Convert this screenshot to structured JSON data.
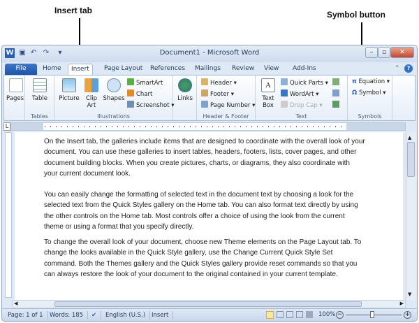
{
  "callouts": {
    "insert_tab": "Insert tab",
    "symbol_button": "Symbol button"
  },
  "window": {
    "title": "Document1 - Microsoft Word",
    "app_icon": "W",
    "controls": {
      "minimize": "–",
      "maximize": "▫",
      "close": "✕"
    }
  },
  "tabs": [
    {
      "label": "File"
    },
    {
      "label": "Home"
    },
    {
      "label": "Insert",
      "active": true
    },
    {
      "label": "Page Layout"
    },
    {
      "label": "References"
    },
    {
      "label": "Mailings"
    },
    {
      "label": "Review"
    },
    {
      "label": "View"
    },
    {
      "label": "Add-Ins"
    }
  ],
  "ribbon": {
    "pages": {
      "label": "Pages"
    },
    "tables": {
      "table": "Table",
      "group": "Tables"
    },
    "illustrations": {
      "picture": "Picture",
      "clip_art": "Clip Art",
      "shapes": "Shapes",
      "smartart": "SmartArt",
      "chart": "Chart",
      "screenshot": "Screenshot",
      "group": "Illustrations"
    },
    "links": {
      "label": "Links"
    },
    "header_footer": {
      "header": "Header",
      "footer": "Footer",
      "page_number": "Page Number",
      "group": "Header & Footer"
    },
    "text": {
      "text_box": "Text Box",
      "quick_parts": "Quick Parts",
      "wordart": "WordArt",
      "drop_cap": "Drop Cap",
      "group": "Text"
    },
    "symbols": {
      "equation": "Equation",
      "symbol": "Symbol",
      "group": "Symbols"
    }
  },
  "document": {
    "paragraphs": [
      "On the Insert tab, the galleries include items that are designed to coordinate with the overall look of your document. You can use these galleries to insert tables, headers, footers, lists, cover pages, and other document building blocks. When you create pictures, charts, or diagrams, they also coordinate with your current document look.",
      "You can easily change the formatting of selected text in the document text by choosing a look for the selected text from the Quick Styles gallery on the Home tab. You can also format text directly by using the other controls on the Home tab. Most controls offer a choice of using the look from the current theme or using a format that you specify directly.",
      "To change the overall look of your document, choose new Theme elements on the Page Layout tab. To change the looks available in the Quick Style gallery, use the Change Current Quick Style Set command. Both the Themes gallery and the Quick Styles gallery provide reset commands so that you can always restore the look of your document to the original contained in your current template."
    ]
  },
  "status": {
    "page": "Page: 1 of 1",
    "words": "Words: 185",
    "language": "English (U.S.)",
    "mode": "Insert",
    "zoom": "100%",
    "zoom_percent": 100
  }
}
